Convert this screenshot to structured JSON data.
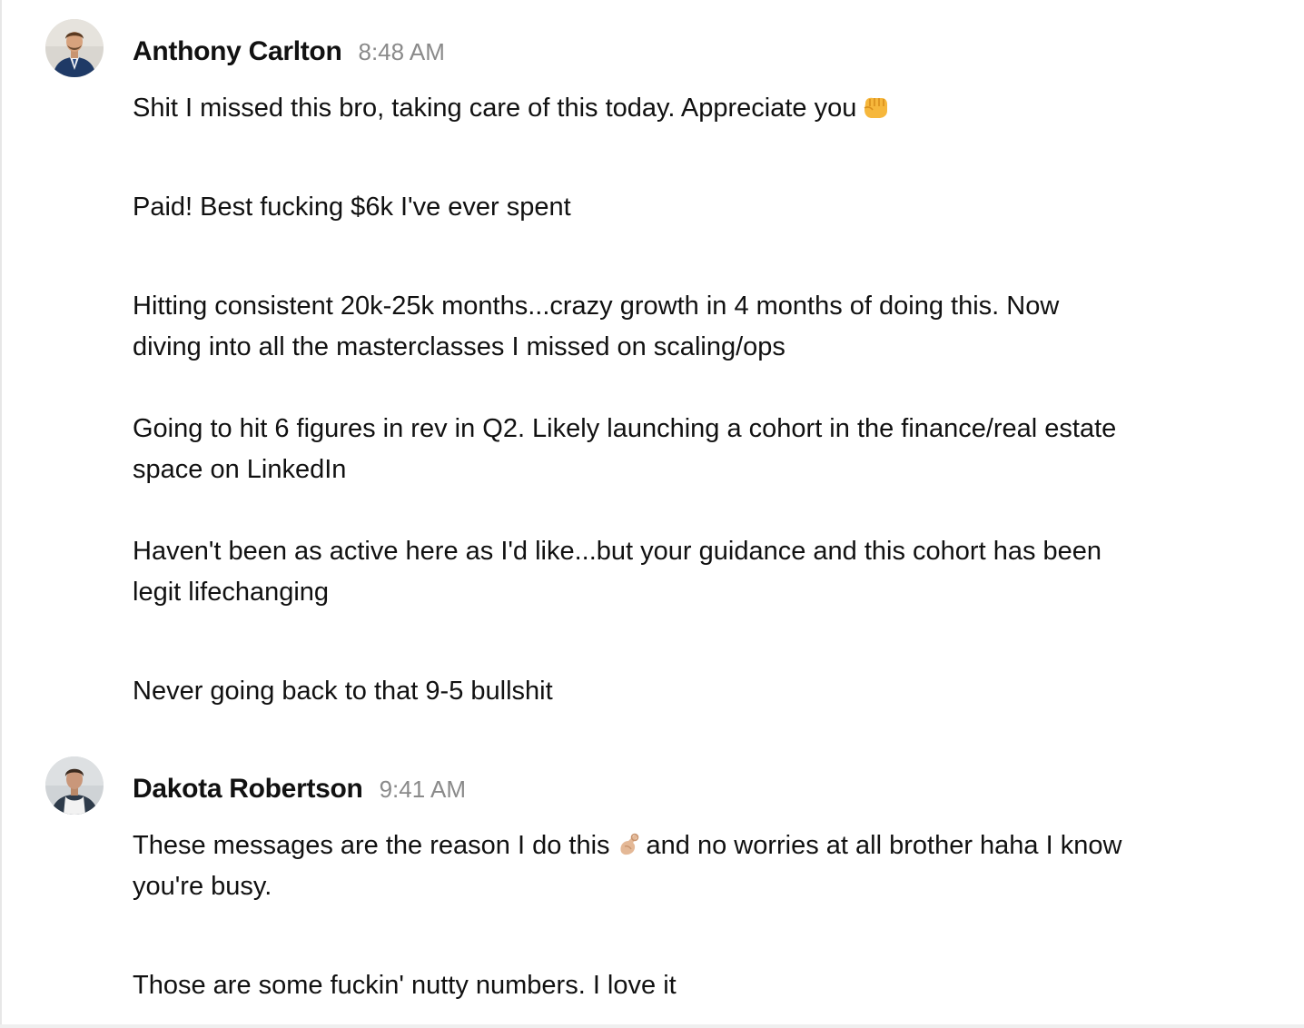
{
  "messages": [
    {
      "author": "Anthony Carlton",
      "time": "8:48 AM",
      "lines": {
        "l1": "Shit I missed this bro, taking care of this today. Appreciate you",
        "l2": "Paid! Best fucking $6k I've ever spent",
        "l3": "Hitting consistent 20k-25k months...crazy growth in 4 months of doing this. Now",
        "l4": "diving into all the masterclasses I missed on scaling/ops",
        "l5": "Going to hit 6 figures in rev in Q2. Likely launching a cohort in the finance/real estate",
        "l6": "space on LinkedIn",
        "l7": "Haven't been as active here as I'd like...but your guidance and this cohort has been",
        "l8": "legit lifechanging",
        "l9": "Never going back to that 9-5 bullshit"
      },
      "emoji": "fist-bump"
    },
    {
      "author": "Dakota Robertson",
      "time": "9:41 AM",
      "lines": {
        "l1a": "These messages are the reason I do this",
        "l1b": "and no worries at all brother haha I know",
        "l2": "you're busy.",
        "l3": "Those are some fuckin' nutty numbers. I love it"
      },
      "emoji": "pinched-fingers"
    }
  ],
  "colors": {
    "text": "#111111",
    "timestamp": "#8a8a8a",
    "background": "#ffffff"
  }
}
